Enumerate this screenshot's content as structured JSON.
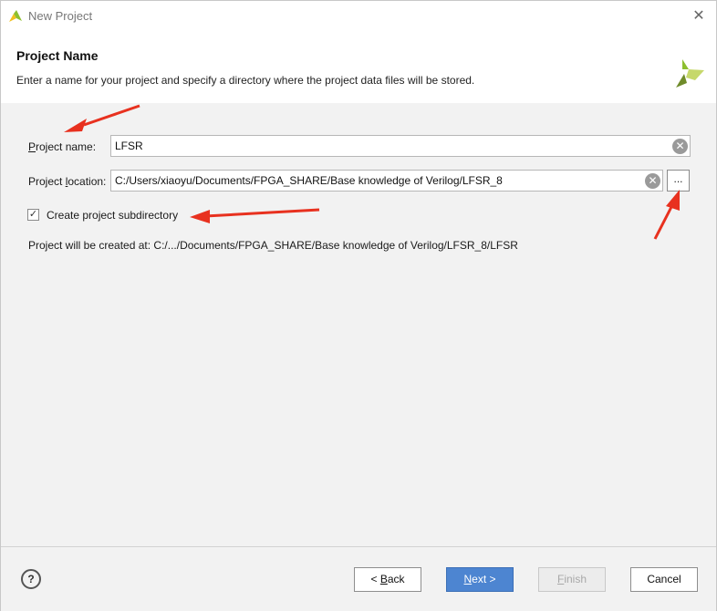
{
  "window": {
    "title": "New Project",
    "app_icon": "vivado-logo-icon",
    "close_icon": "close-icon"
  },
  "header": {
    "title": "Project Name",
    "description": "Enter a name for your project and specify a directory where the project data files will be stored.",
    "logo_icon": "xilinx-logo-icon"
  },
  "form": {
    "project_name": {
      "label_mnemonic": "P",
      "label_rest": "roject name:",
      "value": "LFSR"
    },
    "project_location": {
      "label_prefix": "Project ",
      "label_mnemonic": "l",
      "label_rest": "ocation:",
      "value": "C:/Users/xiaoyu/Documents/FPGA_SHARE/Base knowledge of Verilog/LFSR_8"
    },
    "browse_label": "...",
    "create_subdirectory": {
      "label": "Create project subdirectory",
      "checked": true
    },
    "created_at": "Project will be created at: C:/.../Documents/FPGA_SHARE/Base knowledge of Verilog/LFSR_8/LFSR"
  },
  "footer": {
    "help_label": "?",
    "back": {
      "prefix": "< ",
      "mnemonic": "B",
      "rest": "ack"
    },
    "next": {
      "mnemonic": "N",
      "rest": "ext >"
    },
    "finish": {
      "mnemonic": "F",
      "rest": "inish"
    },
    "cancel": "Cancel"
  },
  "colors": {
    "accent": "#4d85d1",
    "annotation": "#e8311f",
    "logo_green": "#8dbf2f"
  }
}
